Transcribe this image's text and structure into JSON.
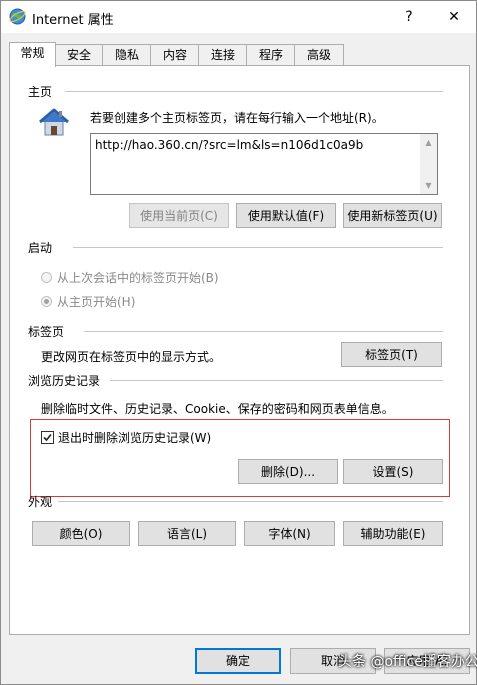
{
  "window": {
    "title": "Internet 属性",
    "help_label": "?",
    "close_label": "✕"
  },
  "tabs": [
    {
      "label": "常规"
    },
    {
      "label": "安全"
    },
    {
      "label": "隐私"
    },
    {
      "label": "内容"
    },
    {
      "label": "连接"
    },
    {
      "label": "程序"
    },
    {
      "label": "高级"
    }
  ],
  "homepage": {
    "section_title": "主页",
    "instruction": "若要创建多个主页标签页，请在每行输入一个地址(R)。",
    "url_value": "http://hao.360.cn/?src=lm&ls=n106d1c0a9b",
    "use_current_label": "使用当前页(C)",
    "use_default_label": "使用默认值(F)",
    "use_new_tab_label": "使用新标签页(U)"
  },
  "startup": {
    "section_title": "启动",
    "option_restore_label": "从上次会话中的标签页开始(B)",
    "option_home_label": "从主页开始(H)",
    "selected": "home"
  },
  "tabs_section": {
    "section_title": "标签页",
    "description": "更改网页在标签页中的显示方式。",
    "button_label": "标签页(T)"
  },
  "history": {
    "section_title": "浏览历史记录",
    "description": "删除临时文件、历史记录、Cookie、保存的密码和网页表单信息。",
    "delete_on_exit_label": "退出时删除浏览历史记录(W)",
    "delete_on_exit_checked": true,
    "delete_label": "删除(D)...",
    "settings_label": "设置(S)"
  },
  "appearance": {
    "section_title": "外观",
    "colors_label": "颜色(O)",
    "languages_label": "语言(L)",
    "fonts_label": "字体(N)",
    "accessibility_label": "辅助功能(E)"
  },
  "footer": {
    "ok_label": "确定",
    "cancel_label": "取消",
    "apply_label": "应用(A)"
  },
  "watermark": "头条 @office播客办公",
  "colors": {
    "highlight_border": "#d83b3b",
    "default_button_border": "#0078d7"
  }
}
